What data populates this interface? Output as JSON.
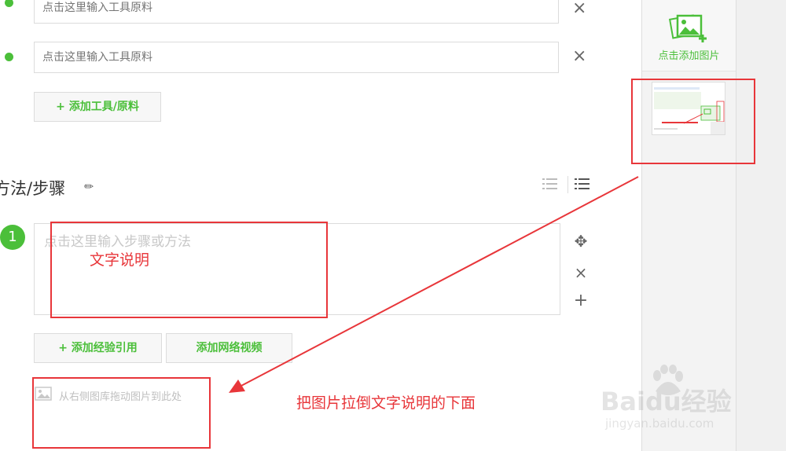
{
  "tools": {
    "rows": [
      {
        "placeholder": "点击这里输入工具原料"
      },
      {
        "placeholder": "点击这里输入工具原料"
      }
    ],
    "add_button": "+ 添加工具/原料"
  },
  "steps_section": {
    "title": "方法/步骤",
    "step_number": "1",
    "step_placeholder": "点击这里输入步骤或方法",
    "add_reference_button": "+ 添加经验引用",
    "add_video_button": "添加网络视频",
    "drop_hint": "从右侧图库拖动图片到此处"
  },
  "sidebar": {
    "add_image_label": "点击添加图片"
  },
  "annotations": {
    "text_note": "文字说明",
    "instruction": "把图片拉倒文字说明的下面"
  },
  "watermark": {
    "brand": "Baidu经验",
    "url": "jingyan.baidu.com"
  },
  "colors": {
    "accent_green": "#4bbf3a",
    "annotation_red": "#e8363a"
  }
}
